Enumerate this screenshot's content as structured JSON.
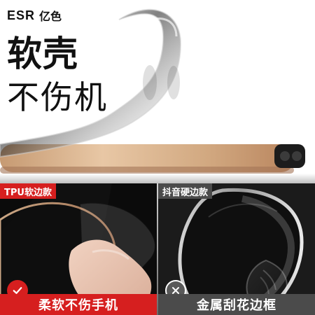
{
  "brand": {
    "logo_mark": "ESR",
    "logo_cn": "亿色"
  },
  "hero": {
    "headline": "软壳",
    "subhead": "不伤机"
  },
  "comparison": {
    "left": {
      "tag": "TPU软边款",
      "caption": "柔软不伤手机",
      "status_icon": "check-icon"
    },
    "right": {
      "tag": "抖音硬边款",
      "caption": "金属刮花边框",
      "status_icon": "x-icon"
    }
  },
  "colors": {
    "accent_red": "#d61f1f",
    "dark_gray": "#4b4b4b"
  }
}
